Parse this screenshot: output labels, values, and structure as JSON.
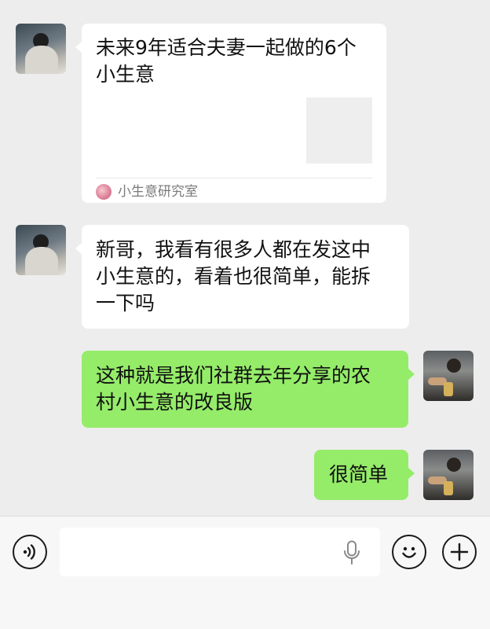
{
  "messages": [
    {
      "type": "link_card",
      "side": "left",
      "title": "未来9年适合夫妻一起做的6个小生意",
      "source": "小生意研究室"
    },
    {
      "type": "text",
      "side": "left",
      "lines": [
        "新哥，我看有很多人都在发这中",
        "小生意的，看着也很简单，能拆",
        "一下吗"
      ]
    },
    {
      "type": "text",
      "side": "right",
      "lines": [
        "这种就是我们社群去年分享的农",
        "村小生意的改良版"
      ]
    },
    {
      "type": "text",
      "side": "right",
      "lines": [
        "很简单"
      ]
    }
  ],
  "input_bar": {
    "icons": [
      "voice-icon",
      "mic-icon",
      "emoji-icon",
      "plus-icon"
    ],
    "placeholder": ""
  },
  "colors": {
    "background": "#ededed",
    "bubble_in": "#ffffff",
    "bubble_out": "#95ec69",
    "input_bar": "#f7f7f7"
  }
}
